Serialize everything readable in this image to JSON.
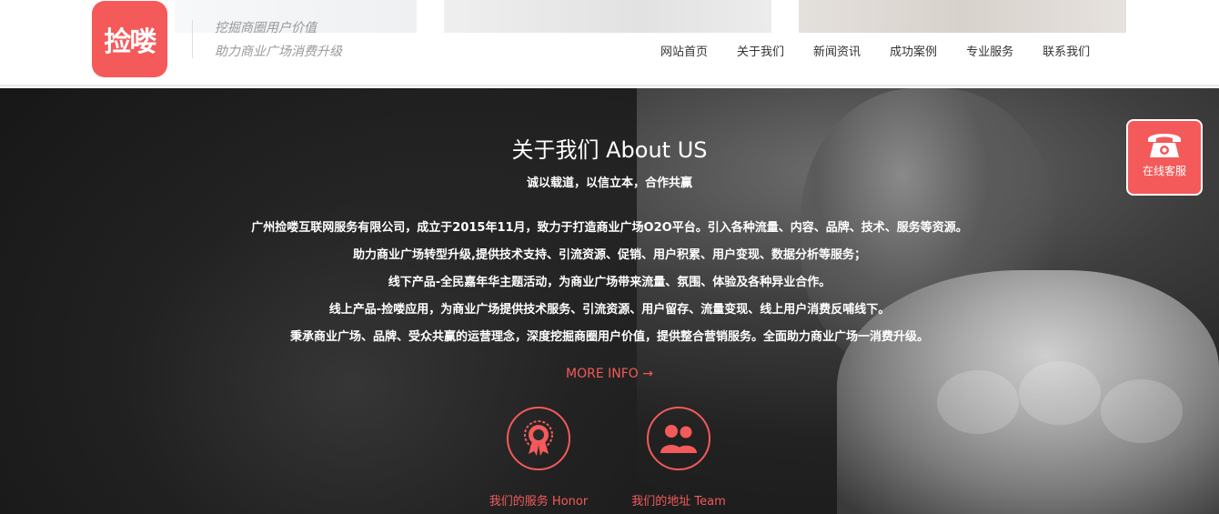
{
  "header": {
    "logo_text": "捡喽",
    "slogan_1": "挖掘商圈用户价值",
    "slogan_2": "助力商业广场消费升级",
    "nav": [
      "网站首页",
      "关于我们",
      "新闻资讯",
      "成功案例",
      "专业服务",
      "联系我们"
    ]
  },
  "hero": {
    "title": "关于我们 About US",
    "subtitle": "诚以载道，以信立本，合作共赢",
    "paragraphs": [
      "广州捡喽互联网服务有限公司，成立于2015年11月，致力于打造商业广场O2O平台。引入各种流量、内容、品牌、技术、服务等资源。",
      "助力商业广场转型升级,提供技术支持、引流资源、促销、用户积累、用户变现、数据分析等服务；",
      "线下产品-全民嘉年华主题活动，为商业广场带来流量、氛围、体验及各种异业合作。",
      "线上产品-捡喽应用，为商业广场提供技术服务、引流资源、用户留存、流量变现、线上用户消费反哺线下。",
      "秉承商业广场、品牌、受众共赢的运营理念，深度挖掘商圈用户价值，提供整合营销服务。全面助力商业广场一消费升级。"
    ],
    "more_info": "MORE INFO →",
    "features": [
      {
        "label": "我们的服务 Honor",
        "icon": "medal-icon"
      },
      {
        "label": "我们的地址 Team",
        "icon": "team-icon"
      }
    ]
  },
  "side_widget": {
    "label": "在线客服",
    "icon": "phone-icon"
  },
  "colors": {
    "accent": "#f45a5a",
    "hero_text": "#ffffff",
    "nav_text": "#333333"
  }
}
